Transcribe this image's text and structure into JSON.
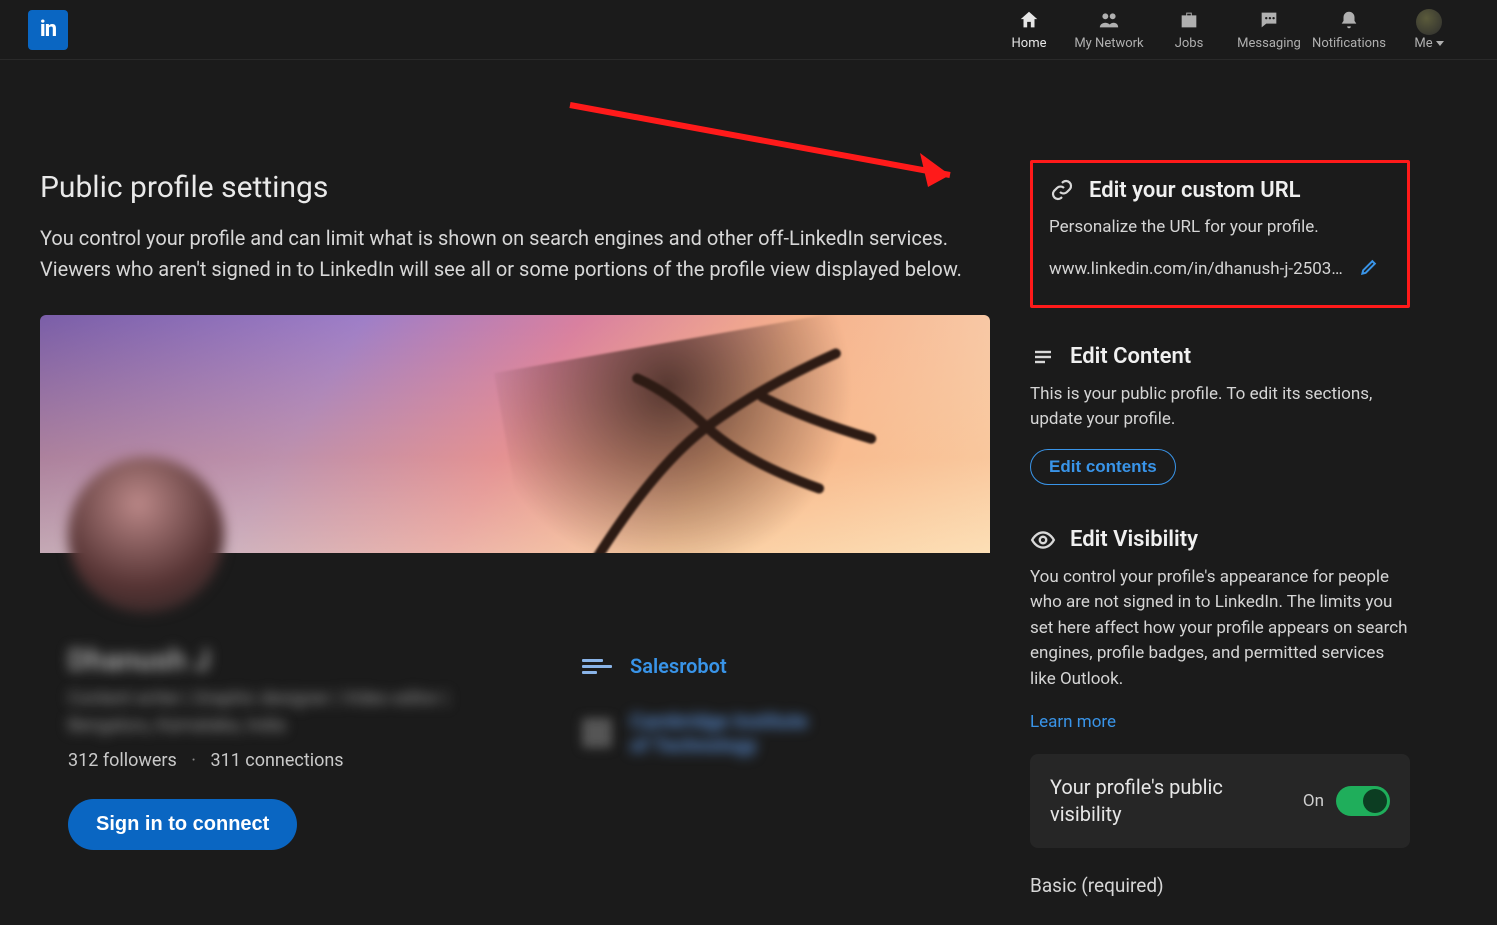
{
  "nav": {
    "logoText": "in",
    "items": [
      {
        "key": "home",
        "label": "Home"
      },
      {
        "key": "network",
        "label": "My Network"
      },
      {
        "key": "jobs",
        "label": "Jobs"
      },
      {
        "key": "messaging",
        "label": "Messaging"
      },
      {
        "key": "notifications",
        "label": "Notifications"
      }
    ],
    "meLabel": "Me"
  },
  "page": {
    "title": "Public profile settings",
    "description": "You control your profile and can limit what is shown on search engines and other off-LinkedIn services. Viewers who aren't signed in to LinkedIn will see all or some portions of the profile view displayed below."
  },
  "profile": {
    "name": "Dhanush J",
    "headline": "Content writer | Graphic designer | Video editor |",
    "location": "Bengaluru, Karnataka, India",
    "followers": "312 followers",
    "connections": "311 connections",
    "signinLabel": "Sign in to connect",
    "company1": "Salesrobot",
    "company2": "Cambridge Institute of Technology"
  },
  "side": {
    "customUrl": {
      "title": "Edit your custom URL",
      "desc": "Personalize the URL for your profile.",
      "url": "www.linkedin.com/in/dhanush-j-2503a…"
    },
    "editContent": {
      "title": "Edit Content",
      "desc": "This is your public profile. To edit its sections, update your profile.",
      "button": "Edit contents"
    },
    "visibility": {
      "title": "Edit Visibility",
      "desc": "You control your profile's appearance for people who are not signed in to LinkedIn. The limits you set here affect how your profile appears on search engines, profile badges, and permitted services like Outlook.",
      "learnMore": "Learn more",
      "toggleLabel": "Your profile's public visibility",
      "toggleState": "On",
      "basic": "Basic (required)"
    }
  }
}
